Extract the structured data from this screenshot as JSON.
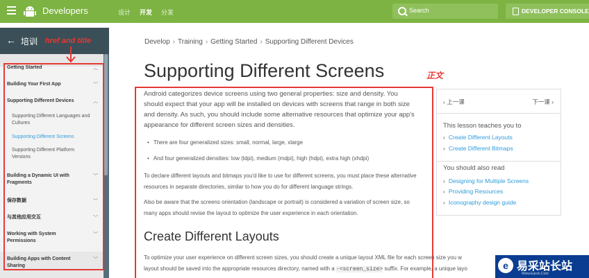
{
  "header": {
    "brand": "Developers",
    "tabs": [
      "设计",
      "开发",
      "分发"
    ],
    "active_tab": 1,
    "search_label": "Search",
    "console_label": "DEVELOPER CONSOLE"
  },
  "sidebar": {
    "title": "培训",
    "items": [
      {
        "label": "Getting Started",
        "type": "section"
      },
      {
        "label": "Building Your First App",
        "type": "section"
      },
      {
        "label": "Supporting Different Devices",
        "type": "section"
      },
      {
        "label": "Supporting Different Languages and Cultures",
        "type": "sub"
      },
      {
        "label": "Supporting Different Screens",
        "type": "sub-current"
      },
      {
        "label": "Supporting Different Platform Versions",
        "type": "sub"
      },
      {
        "label": "Building a Dynamic UI with Fragments",
        "type": "section"
      },
      {
        "label": "保存数据",
        "type": "section"
      },
      {
        "label": "与其他应用交互",
        "type": "section"
      },
      {
        "label": "Working with System Permissions",
        "type": "section"
      },
      {
        "label": "Building Apps with Content Sharing",
        "type": "section"
      }
    ]
  },
  "annotations": {
    "href_title": "href and title",
    "main_text": "正文"
  },
  "breadcrumb": [
    "Develop",
    "Training",
    "Getting Started",
    "Supporting Different Devices"
  ],
  "main": {
    "title": "Supporting Different Screens",
    "intro": "Android categorizes device screens using two general properties: size and density. You should expect that your app will be installed on devices with screens that range in both size and density. As such, you should include some alternative resources that optimize your app's appearance for different screen sizes and densities.",
    "bullets": [
      "There are four generalized sizes: small, normal, large, xlarge",
      "And four generalized densities: low (ldpi), medium (mdpi), high (hdpi), extra high (xhdpi)"
    ],
    "para2": "To declare different layouts and bitmaps you'd like to use for different screens, you must place these alternative resources in separate directories, similar to how you do for different language strings.",
    "para3": "Also be aware that the screens orientation (landscape or portrait) is considered a variation of screen size, so many apps should revise the layout to optimize the user experience in each orientation.",
    "h2": "Create Different Layouts",
    "para4_line1": "To optimize your user experience on different screen sizes, you should create a unique layout XML file for each screen size you w",
    "para4_line2a": "layout should be saved into the appropriate resources directory, named with a ",
    "para4_code": "-<screen_size>",
    "para4_line2b": " suffix. For example, a unique layo"
  },
  "lesson_panel": {
    "prev": "上一课",
    "next": "下一课",
    "teaches_heading": "This lesson teaches you to",
    "teaches": [
      "Create Different Layouts",
      "Create Different Bitmaps"
    ],
    "read_heading": "You should also read",
    "read": [
      "Designing for Multiple Screens",
      "Providing Resources",
      "Iconography design guide"
    ]
  },
  "watermark": {
    "text": "易采站长站",
    "url": "Www.Easck.Com"
  }
}
